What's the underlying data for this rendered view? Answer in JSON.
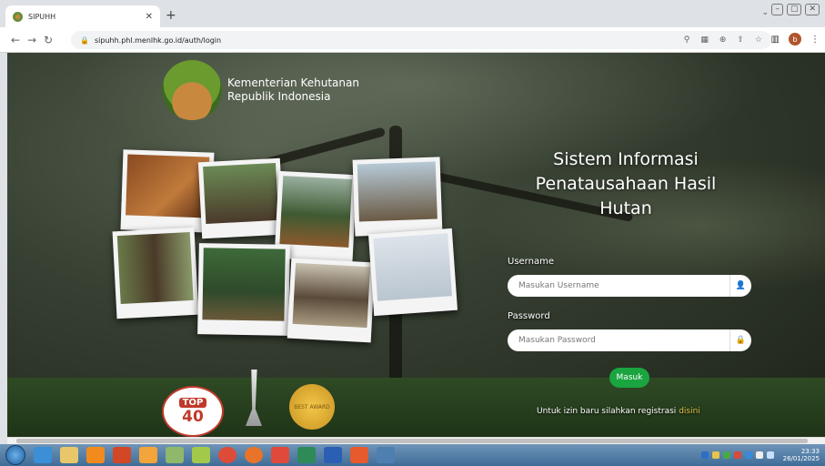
{
  "browser": {
    "tab_title": "SIPUHH",
    "url": "sipuhh.phl.menlhk.go.id/auth/login",
    "profile_initial": "b"
  },
  "site": {
    "org_line1": "Kementerian Kehutanan",
    "org_line2": "Republik Indonesia",
    "title_line1": "Sistem Informasi",
    "title_line2": "Penatausahaan Hasil",
    "title_line3": "Hutan"
  },
  "login": {
    "username_label": "Username",
    "username_placeholder": "Masukan Username",
    "password_label": "Password",
    "password_placeholder": "Masukan Password",
    "submit_label": "Masuk",
    "register_text": "Untuk izin baru silahkan registrasi",
    "register_link": "disini"
  },
  "badges": {
    "top_label": "TOP",
    "top_number": "40",
    "award_text": "BEST AWARD"
  },
  "taskbar": {
    "time": "23:33",
    "date": "26/01/2025"
  }
}
